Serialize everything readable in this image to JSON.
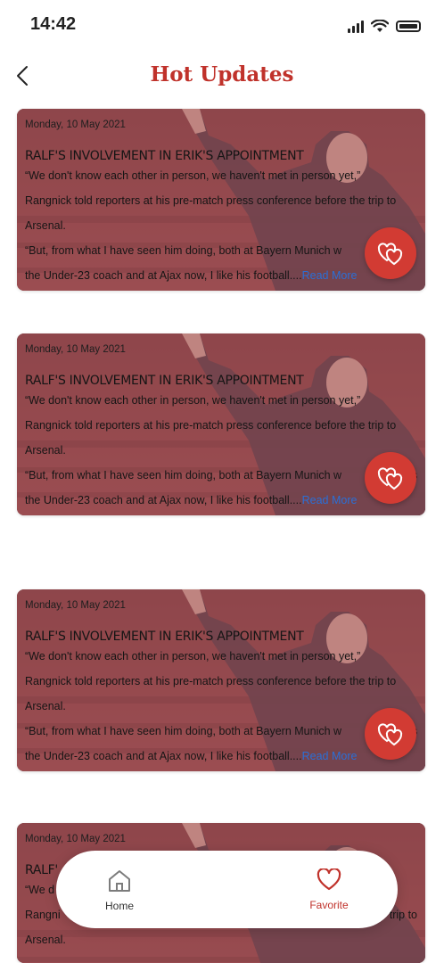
{
  "status_bar": {
    "time": "14:42"
  },
  "header": {
    "title": "Hot Updates",
    "back_icon": "chevron-left-icon"
  },
  "accent_color": "#c0322b",
  "link_color": "#2a6fd6",
  "cards": [
    {
      "date": "Monday, 10 May 2021",
      "headline": "RALF'S INVOLVEMENT IN ERIK'S APPOINTMENT",
      "line1": "“We don't know each other in person, we haven't met in person yet,”",
      "line2": "Rangnick told reporters at his pre-match press conference before the trip to",
      "line3": "Arsenal.",
      "line4": "“But, from what I have seen him doing, both at Bayern Munich w",
      "line4_tail": "",
      "line5": "the Under-23 coach and at Ajax now, I like his football....",
      "read_more": "Read More",
      "favorite_icon": "hearts-icon"
    },
    {
      "date": "Monday, 10 May 2021",
      "headline": "RALF'S INVOLVEMENT IN ERIK'S APPOINTMENT",
      "line1": "“We don't know each other in person, we haven't met in person yet,”",
      "line2": "Rangnick told reporters at his pre-match press conference before the trip to",
      "line3": "Arsenal.",
      "line4": "“But, from what I have seen him doing, both at Bayern Munich w",
      "line4_tail": "as",
      "line5": "the Under-23 coach and at Ajax now, I like his football....",
      "read_more": "Read More",
      "favorite_icon": "hearts-icon"
    },
    {
      "date": "Monday, 10 May 2021",
      "headline": "RALF'S INVOLVEMENT IN ERIK'S APPOINTMENT",
      "line1": "“We don't know each other in person, we haven't met in person yet,”",
      "line2": "Rangnick told reporters at his pre-match press conference before the trip to",
      "line3": "Arsenal.",
      "line4": "“But, from what I have seen him doing, both at Bayern Munich w",
      "line4_tail": "as",
      "line5": "the Under-23 coach and at Ajax now, I like his football....",
      "read_more": "Read More",
      "favorite_icon": "hearts-icon"
    },
    {
      "date": "Monday, 10 May 2021",
      "headline": "RALF'",
      "line1": "“We d",
      "line2": "Rangni",
      "line2_tail": "trip to",
      "line3": "Arsenal."
    }
  ],
  "bottom_nav": {
    "items": [
      {
        "label": "Home",
        "icon": "home-icon",
        "active": false
      },
      {
        "label": "Favorite",
        "icon": "heart-icon",
        "active": true
      }
    ]
  }
}
